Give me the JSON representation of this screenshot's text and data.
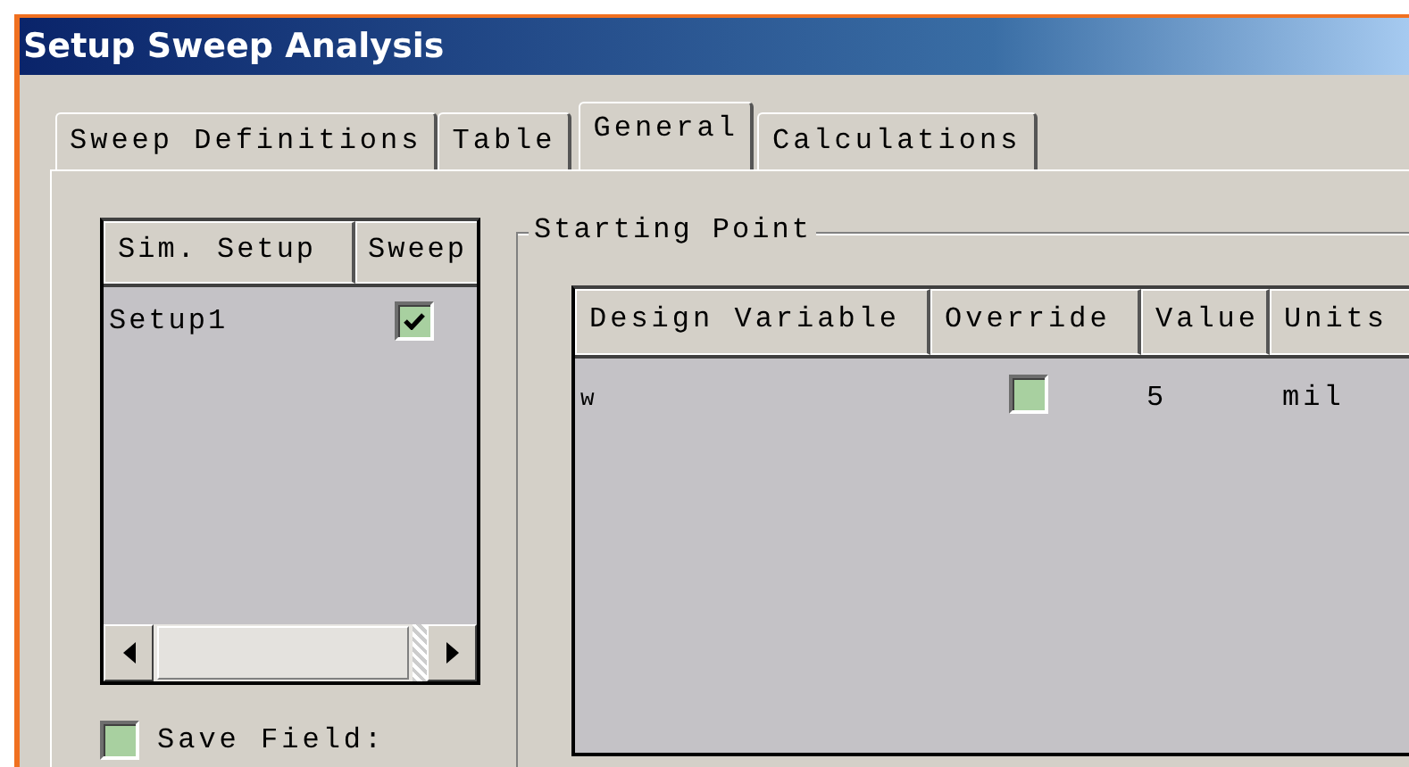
{
  "window": {
    "title": "Setup Sweep Analysis"
  },
  "tabs": [
    {
      "label": "Sweep Definitions",
      "selected": false
    },
    {
      "label": "Table",
      "selected": false
    },
    {
      "label": "General",
      "selected": true
    },
    {
      "label": "Calculations",
      "selected": false
    }
  ],
  "sim_list": {
    "columns": [
      "Sim. Setup",
      "Sweep"
    ],
    "rows": [
      {
        "setup": "Setup1",
        "sweep": true
      }
    ]
  },
  "save_field": {
    "label": "Save Field:",
    "checked": false
  },
  "starting_point": {
    "title": "Starting Point",
    "columns": [
      "Design Variable",
      "Override",
      "Value",
      "Units"
    ],
    "rows": [
      {
        "variable": "w",
        "override": false,
        "value": "5",
        "units": "mil"
      }
    ]
  }
}
